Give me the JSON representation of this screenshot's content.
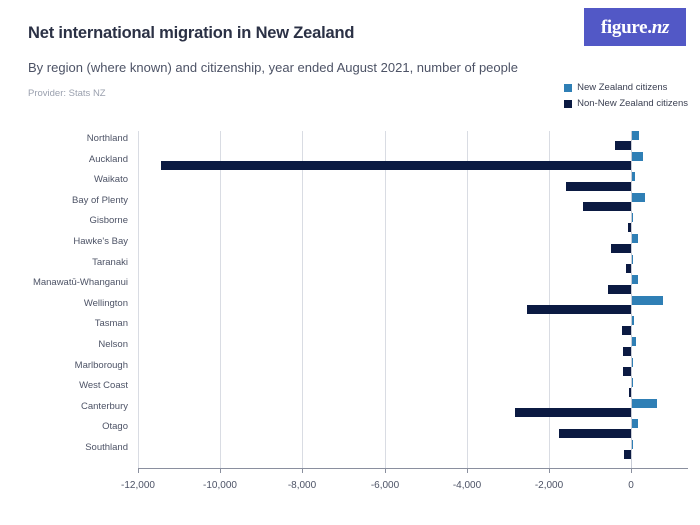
{
  "header": {
    "title": "Net international migration in New Zealand",
    "subtitle": "By region (where known) and citizenship, year ended August 2021, number of people",
    "provider": "Provider: Stats NZ"
  },
  "logo": {
    "primary": "figure.",
    "accent": "nz",
    "background_color": "#5258c6"
  },
  "legend": {
    "items": [
      {
        "label": "New Zealand citizens",
        "color": "#2f7fb5"
      },
      {
        "label": "Non-New Zealand citizens",
        "color": "#0b1a42"
      }
    ]
  },
  "chart_data": {
    "type": "bar",
    "orientation": "horizontal",
    "title": "Net international migration in New Zealand",
    "subtitle": "By region (where known) and citizenship, year ended August 2021, number of people",
    "xlabel": "",
    "ylabel": "",
    "xlim": [
      -12000,
      1400
    ],
    "xticks": [
      -12000,
      -10000,
      -8000,
      -6000,
      -4000,
      -2000,
      0
    ],
    "xtick_labels": [
      "-12,000",
      "-10,000",
      "-8,000",
      "-6,000",
      "-4,000",
      "-2,000",
      "0"
    ],
    "grid": true,
    "legend_position": "top-right",
    "categories": [
      "Northland",
      "Auckland",
      "Waikato",
      "Bay of Plenty",
      "Gisborne",
      "Hawke's Bay",
      "Taranaki",
      "Manawatū-Whanganui",
      "Wellington",
      "Tasman",
      "Nelson",
      "Marlborough",
      "West Coast",
      "Canterbury",
      "Otago",
      "Southland"
    ],
    "series": [
      {
        "name": "New Zealand citizens",
        "color": "#2f7fb5",
        "values": [
          190,
          280,
          90,
          330,
          60,
          180,
          30,
          160,
          790,
          70,
          110,
          60,
          20,
          640,
          170,
          20
        ]
      },
      {
        "name": "Non-New Zealand citizens",
        "color": "#0b1a42",
        "values": [
          -400,
          -11430,
          -1580,
          -1170,
          -70,
          -480,
          -130,
          -560,
          -2540,
          -230,
          -190,
          -200,
          -40,
          -2830,
          -1760,
          -180
        ]
      }
    ]
  }
}
